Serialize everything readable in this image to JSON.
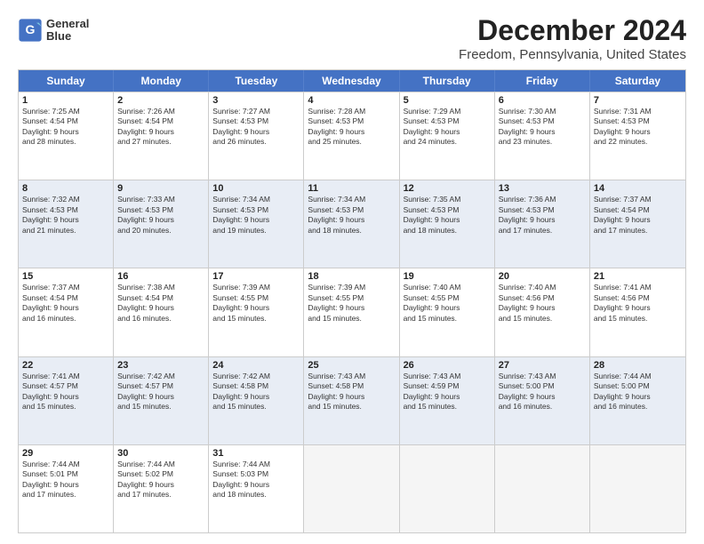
{
  "header": {
    "logo_line1": "General",
    "logo_line2": "Blue",
    "main_title": "December 2024",
    "subtitle": "Freedom, Pennsylvania, United States"
  },
  "days_of_week": [
    "Sunday",
    "Monday",
    "Tuesday",
    "Wednesday",
    "Thursday",
    "Friday",
    "Saturday"
  ],
  "weeks": [
    [
      {
        "day": 1,
        "lines": [
          "Sunrise: 7:25 AM",
          "Sunset: 4:54 PM",
          "Daylight: 9 hours",
          "and 28 minutes."
        ],
        "empty": false,
        "alt": false
      },
      {
        "day": 2,
        "lines": [
          "Sunrise: 7:26 AM",
          "Sunset: 4:54 PM",
          "Daylight: 9 hours",
          "and 27 minutes."
        ],
        "empty": false,
        "alt": false
      },
      {
        "day": 3,
        "lines": [
          "Sunrise: 7:27 AM",
          "Sunset: 4:53 PM",
          "Daylight: 9 hours",
          "and 26 minutes."
        ],
        "empty": false,
        "alt": false
      },
      {
        "day": 4,
        "lines": [
          "Sunrise: 7:28 AM",
          "Sunset: 4:53 PM",
          "Daylight: 9 hours",
          "and 25 minutes."
        ],
        "empty": false,
        "alt": false
      },
      {
        "day": 5,
        "lines": [
          "Sunrise: 7:29 AM",
          "Sunset: 4:53 PM",
          "Daylight: 9 hours",
          "and 24 minutes."
        ],
        "empty": false,
        "alt": false
      },
      {
        "day": 6,
        "lines": [
          "Sunrise: 7:30 AM",
          "Sunset: 4:53 PM",
          "Daylight: 9 hours",
          "and 23 minutes."
        ],
        "empty": false,
        "alt": false
      },
      {
        "day": 7,
        "lines": [
          "Sunrise: 7:31 AM",
          "Sunset: 4:53 PM",
          "Daylight: 9 hours",
          "and 22 minutes."
        ],
        "empty": false,
        "alt": false
      }
    ],
    [
      {
        "day": 8,
        "lines": [
          "Sunrise: 7:32 AM",
          "Sunset: 4:53 PM",
          "Daylight: 9 hours",
          "and 21 minutes."
        ],
        "empty": false,
        "alt": true
      },
      {
        "day": 9,
        "lines": [
          "Sunrise: 7:33 AM",
          "Sunset: 4:53 PM",
          "Daylight: 9 hours",
          "and 20 minutes."
        ],
        "empty": false,
        "alt": true
      },
      {
        "day": 10,
        "lines": [
          "Sunrise: 7:34 AM",
          "Sunset: 4:53 PM",
          "Daylight: 9 hours",
          "and 19 minutes."
        ],
        "empty": false,
        "alt": true
      },
      {
        "day": 11,
        "lines": [
          "Sunrise: 7:34 AM",
          "Sunset: 4:53 PM",
          "Daylight: 9 hours",
          "and 18 minutes."
        ],
        "empty": false,
        "alt": true
      },
      {
        "day": 12,
        "lines": [
          "Sunrise: 7:35 AM",
          "Sunset: 4:53 PM",
          "Daylight: 9 hours",
          "and 18 minutes."
        ],
        "empty": false,
        "alt": true
      },
      {
        "day": 13,
        "lines": [
          "Sunrise: 7:36 AM",
          "Sunset: 4:53 PM",
          "Daylight: 9 hours",
          "and 17 minutes."
        ],
        "empty": false,
        "alt": true
      },
      {
        "day": 14,
        "lines": [
          "Sunrise: 7:37 AM",
          "Sunset: 4:54 PM",
          "Daylight: 9 hours",
          "and 17 minutes."
        ],
        "empty": false,
        "alt": true
      }
    ],
    [
      {
        "day": 15,
        "lines": [
          "Sunrise: 7:37 AM",
          "Sunset: 4:54 PM",
          "Daylight: 9 hours",
          "and 16 minutes."
        ],
        "empty": false,
        "alt": false
      },
      {
        "day": 16,
        "lines": [
          "Sunrise: 7:38 AM",
          "Sunset: 4:54 PM",
          "Daylight: 9 hours",
          "and 16 minutes."
        ],
        "empty": false,
        "alt": false
      },
      {
        "day": 17,
        "lines": [
          "Sunrise: 7:39 AM",
          "Sunset: 4:55 PM",
          "Daylight: 9 hours",
          "and 15 minutes."
        ],
        "empty": false,
        "alt": false
      },
      {
        "day": 18,
        "lines": [
          "Sunrise: 7:39 AM",
          "Sunset: 4:55 PM",
          "Daylight: 9 hours",
          "and 15 minutes."
        ],
        "empty": false,
        "alt": false
      },
      {
        "day": 19,
        "lines": [
          "Sunrise: 7:40 AM",
          "Sunset: 4:55 PM",
          "Daylight: 9 hours",
          "and 15 minutes."
        ],
        "empty": false,
        "alt": false
      },
      {
        "day": 20,
        "lines": [
          "Sunrise: 7:40 AM",
          "Sunset: 4:56 PM",
          "Daylight: 9 hours",
          "and 15 minutes."
        ],
        "empty": false,
        "alt": false
      },
      {
        "day": 21,
        "lines": [
          "Sunrise: 7:41 AM",
          "Sunset: 4:56 PM",
          "Daylight: 9 hours",
          "and 15 minutes."
        ],
        "empty": false,
        "alt": false
      }
    ],
    [
      {
        "day": 22,
        "lines": [
          "Sunrise: 7:41 AM",
          "Sunset: 4:57 PM",
          "Daylight: 9 hours",
          "and 15 minutes."
        ],
        "empty": false,
        "alt": true
      },
      {
        "day": 23,
        "lines": [
          "Sunrise: 7:42 AM",
          "Sunset: 4:57 PM",
          "Daylight: 9 hours",
          "and 15 minutes."
        ],
        "empty": false,
        "alt": true
      },
      {
        "day": 24,
        "lines": [
          "Sunrise: 7:42 AM",
          "Sunset: 4:58 PM",
          "Daylight: 9 hours",
          "and 15 minutes."
        ],
        "empty": false,
        "alt": true
      },
      {
        "day": 25,
        "lines": [
          "Sunrise: 7:43 AM",
          "Sunset: 4:58 PM",
          "Daylight: 9 hours",
          "and 15 minutes."
        ],
        "empty": false,
        "alt": true
      },
      {
        "day": 26,
        "lines": [
          "Sunrise: 7:43 AM",
          "Sunset: 4:59 PM",
          "Daylight: 9 hours",
          "and 15 minutes."
        ],
        "empty": false,
        "alt": true
      },
      {
        "day": 27,
        "lines": [
          "Sunrise: 7:43 AM",
          "Sunset: 5:00 PM",
          "Daylight: 9 hours",
          "and 16 minutes."
        ],
        "empty": false,
        "alt": true
      },
      {
        "day": 28,
        "lines": [
          "Sunrise: 7:44 AM",
          "Sunset: 5:00 PM",
          "Daylight: 9 hours",
          "and 16 minutes."
        ],
        "empty": false,
        "alt": true
      }
    ],
    [
      {
        "day": 29,
        "lines": [
          "Sunrise: 7:44 AM",
          "Sunset: 5:01 PM",
          "Daylight: 9 hours",
          "and 17 minutes."
        ],
        "empty": false,
        "alt": false
      },
      {
        "day": 30,
        "lines": [
          "Sunrise: 7:44 AM",
          "Sunset: 5:02 PM",
          "Daylight: 9 hours",
          "and 17 minutes."
        ],
        "empty": false,
        "alt": false
      },
      {
        "day": 31,
        "lines": [
          "Sunrise: 7:44 AM",
          "Sunset: 5:03 PM",
          "Daylight: 9 hours",
          "and 18 minutes."
        ],
        "empty": false,
        "alt": false
      },
      {
        "day": null,
        "lines": [],
        "empty": true,
        "alt": false
      },
      {
        "day": null,
        "lines": [],
        "empty": true,
        "alt": false
      },
      {
        "day": null,
        "lines": [],
        "empty": true,
        "alt": false
      },
      {
        "day": null,
        "lines": [],
        "empty": true,
        "alt": false
      }
    ]
  ]
}
